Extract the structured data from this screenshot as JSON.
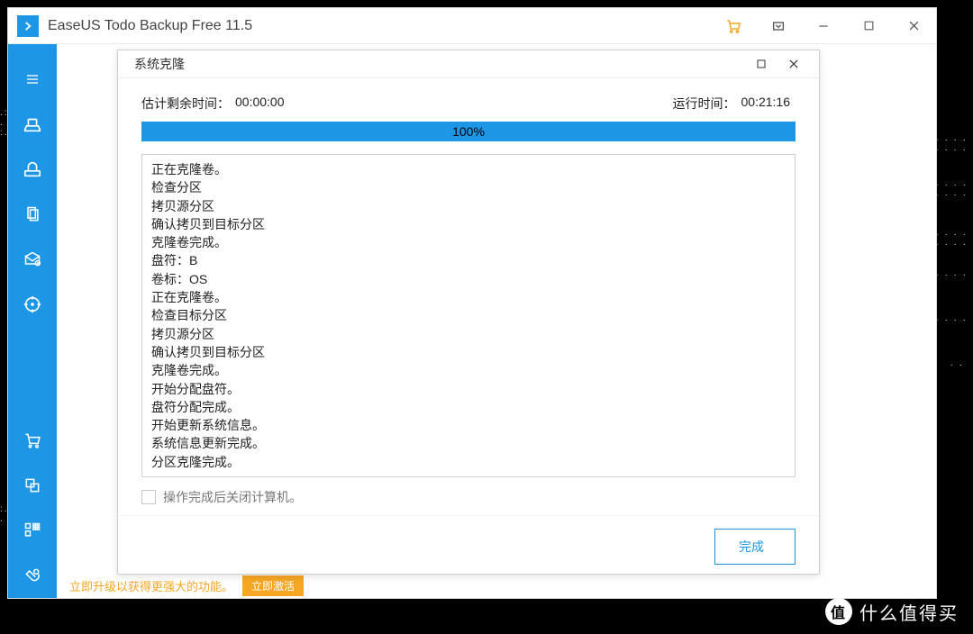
{
  "app": {
    "title": "EaseUS Todo Backup Free 11.5"
  },
  "promo": {
    "text": "立即升级以获得更强大的功能。",
    "button": "立即激活"
  },
  "dialog": {
    "title": "系统克隆",
    "est_label": "估计剩余时间：",
    "est_value": "00:00:00",
    "run_label": "运行时间：",
    "run_value": "00:21:16",
    "progress_text": "100%",
    "log": [
      "正在克隆卷。",
      "检查分区",
      "拷贝源分区",
      "确认拷贝到目标分区",
      "克隆卷完成。",
      "盘符：B",
      "卷标：OS",
      "正在克隆卷。",
      "检查目标分区",
      "拷贝源分区",
      "确认拷贝到目标分区",
      "克隆卷完成。",
      "开始分配盘符。",
      "盘符分配完成。",
      "开始更新系统信息。",
      "系统信息更新完成。",
      "分区克隆完成。"
    ],
    "shutdown_option": "操作完成后关闭计算机。",
    "finish_button": "完成"
  },
  "watermark": {
    "glyph": "值",
    "text": "什么值得买"
  }
}
